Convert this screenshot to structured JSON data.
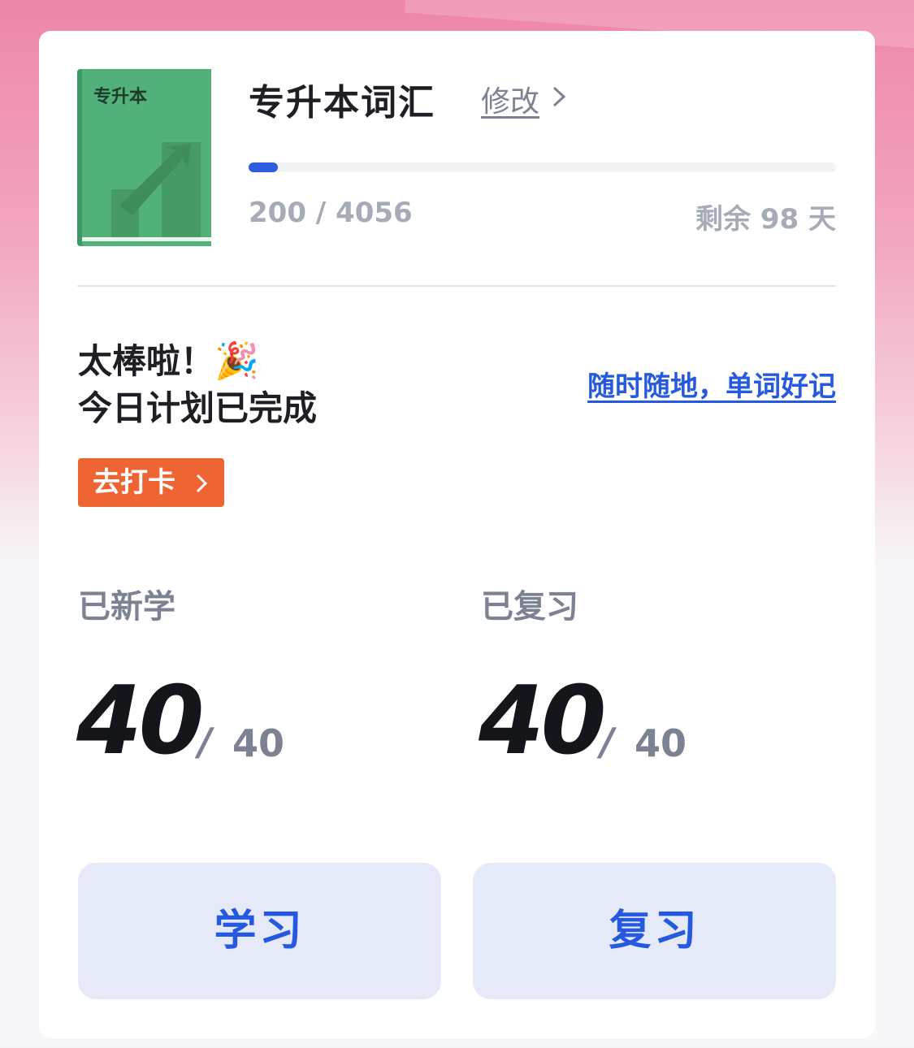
{
  "book": {
    "cover_label": "专升本",
    "title": "专升本词汇",
    "edit_label": "修改",
    "progress_fraction": 0.0493,
    "progress_text": "200 / 4056",
    "days_left_text": "剩余 98 天",
    "cover_color": "#52b07a"
  },
  "status": {
    "line1": "太棒啦！",
    "line2": "今日计划已完成",
    "icon": "party-popper-icon",
    "slogan": "随时随地，单词好记",
    "checkin_label": "去打卡"
  },
  "stats": {
    "new_label": "已新学",
    "new_done": "40",
    "new_total": "40",
    "review_label": "已复习",
    "review_done": "40",
    "review_total": "40",
    "slash": "/"
  },
  "actions": {
    "study_label": "学习",
    "review_label": "复习"
  },
  "colors": {
    "accent": "#2459e0",
    "checkin": "#ee6433",
    "progress": "#2e5ee0"
  }
}
